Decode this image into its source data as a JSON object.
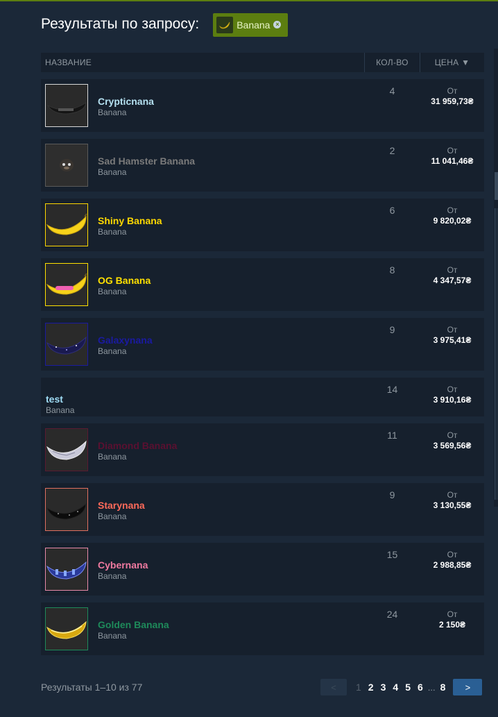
{
  "header": {
    "title": "Результаты по запросу:",
    "tag_label": "Banana"
  },
  "table": {
    "col_name": "НАЗВАНИЕ",
    "col_qty": "КОЛ-ВО",
    "col_price": "ЦЕНА ▼"
  },
  "colors": {
    "background": "#1b2838",
    "row_bg": "#16202d",
    "accent_green": "#5c7e10",
    "next_button": "#2a5f94"
  },
  "rows": [
    {
      "name": "Crypticnana",
      "game": "Banana",
      "qty": "4",
      "from": "От",
      "price": "31 959,73₴",
      "name_color": "#b4e0f0",
      "border": "#d8d8d8",
      "icon": "dark-banana-icon"
    },
    {
      "name": "Sad Hamster Banana",
      "game": "Banana",
      "qty": "2",
      "from": "От",
      "price": "11 041,46₴",
      "name_color": "#7a7a7a",
      "border": "#5a5a5a",
      "icon": "hamster-icon"
    },
    {
      "name": "Shiny Banana",
      "game": "Banana",
      "qty": "6",
      "from": "От",
      "price": "9 820,02₴",
      "name_color": "#ffd800",
      "border": "#ffd800",
      "icon": "yellow-banana-icon"
    },
    {
      "name": "OG Banana",
      "game": "Banana",
      "qty": "8",
      "from": "От",
      "price": "4 347,57₴",
      "name_color": "#ffe000",
      "border": "#ffe000",
      "icon": "og-banana-icon"
    },
    {
      "name": "Galaxynana",
      "game": "Banana",
      "qty": "9",
      "from": "От",
      "price": "3 975,41₴",
      "name_color": "#1a1aa0",
      "border": "#1a1aa0",
      "icon": "galaxy-banana-icon"
    },
    {
      "name": "test",
      "game": "Banana",
      "qty": "14",
      "from": "От",
      "price": "3 910,16₴",
      "name_color": "#9fdcf5",
      "small": true
    },
    {
      "name": "Diamond Banana",
      "game": "Banana",
      "qty": "11",
      "from": "От",
      "price": "3 569,56₴",
      "name_color": "#5a1030",
      "border": "#5a1a30",
      "icon": "diamond-banana-icon"
    },
    {
      "name": "Starynana",
      "game": "Banana",
      "qty": "9",
      "from": "От",
      "price": "3 130,55₴",
      "name_color": "#ff6a5a",
      "border": "#e07060",
      "icon": "starry-banana-icon"
    },
    {
      "name": "Cybernana",
      "game": "Banana",
      "qty": "15",
      "from": "От",
      "price": "2 988,85₴",
      "name_color": "#f07aa0",
      "border": "#e88aa8",
      "icon": "cyber-banana-icon"
    },
    {
      "name": "Golden Banana",
      "game": "Banana",
      "qty": "24",
      "from": "От",
      "price": "2 150₴",
      "name_color": "#1e8a5a",
      "border": "#1e8a5a",
      "icon": "golden-banana-icon"
    }
  ],
  "footer": {
    "results_text": "Результаты 1–10 из 77",
    "prev": "<",
    "next": ">",
    "pages": [
      "1",
      "2",
      "3",
      "4",
      "5",
      "6"
    ],
    "dots": "...",
    "last_page": "8"
  }
}
